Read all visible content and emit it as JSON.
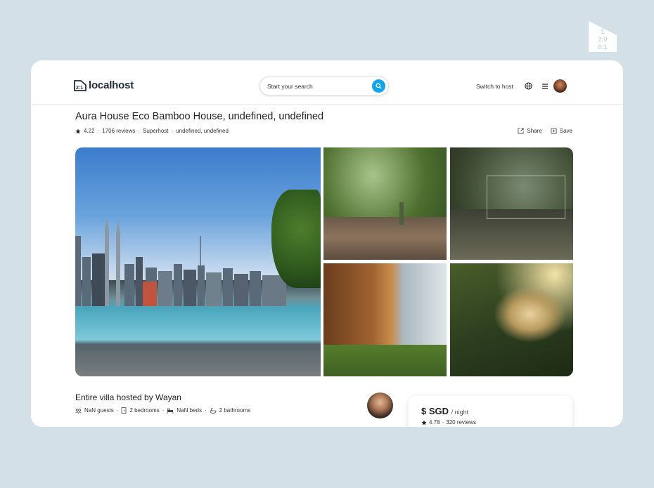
{
  "app": {
    "brand": "localhost",
    "brand_mark": "2:1"
  },
  "corner_logo": {
    "lines": [
      "1",
      "2:0",
      "0:1"
    ]
  },
  "header": {
    "search_placeholder": "Start your search",
    "switch_to_host": "Switch to host"
  },
  "listing": {
    "title": "Aura House Eco Bamboo House, undefined, undefined",
    "rating": "4.22",
    "reviews": "1706 reviews",
    "badge": "Superhost",
    "location": "undefined, undefined",
    "share_label": "Share",
    "save_label": "Save"
  },
  "host": {
    "title": "Entire villa hosted by Wayan",
    "guests": "NaN guests",
    "bedrooms": "2 bedrooms",
    "beds": "NaN beds",
    "bathrooms": "2 bathrooms"
  },
  "booking": {
    "price": "$ SGD",
    "per": "/ night",
    "rating": "4.78",
    "reviews": "320 reviews"
  },
  "icons": [
    "search-icon",
    "globe-icon",
    "menu-icon",
    "star-icon",
    "share-icon",
    "save-icon",
    "guests-icon",
    "bedroom-icon",
    "bed-icon",
    "bathroom-icon"
  ],
  "colors": {
    "accent": "#0ea5e9",
    "background": "#d3e0e8",
    "card": "#ffffff"
  }
}
